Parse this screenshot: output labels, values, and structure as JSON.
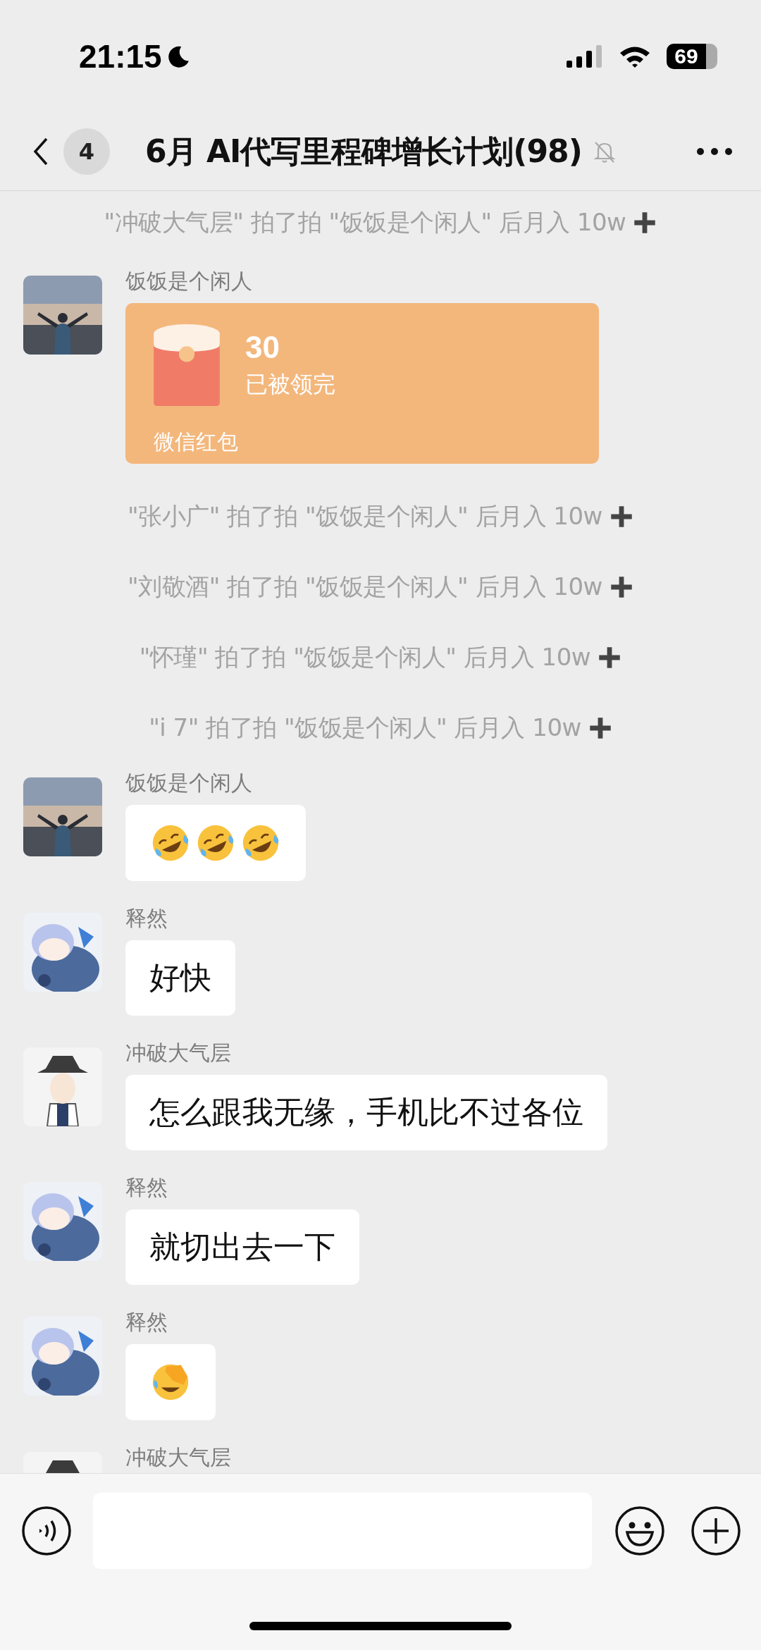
{
  "status_bar": {
    "time": "21:15",
    "battery": "69"
  },
  "nav": {
    "unread": "4",
    "title": "6月 AI代写里程碑增长计划(98)",
    "muted": true
  },
  "messages": [
    {
      "kind": "tickle",
      "text": "\"冲破大气层\" 拍了拍 \"饭饭是个闲人\" 后月入 10w"
    },
    {
      "kind": "red_packet",
      "sender": "饭饭是个闲人",
      "amount": "30",
      "status": "已被领完",
      "footer": "微信红包"
    },
    {
      "kind": "tickle",
      "text": "\"张小广\" 拍了拍 \"饭饭是个闲人\" 后月入 10w"
    },
    {
      "kind": "tickle",
      "text": "\"刘敬酒\" 拍了拍 \"饭饭是个闲人\" 后月入 10w"
    },
    {
      "kind": "tickle",
      "text": "\"怀瑾\" 拍了拍 \"饭饭是个闲人\" 后月入 10w"
    },
    {
      "kind": "tickle",
      "text": "\"i 7\" 拍了拍 \"饭饭是个闲人\" 后月入 10w"
    },
    {
      "kind": "sticker",
      "sender": "饭饭是个闲人",
      "stickers": [
        {
          "kind": "rofl"
        },
        {
          "kind": "rofl"
        },
        {
          "kind": "rofl"
        }
      ]
    },
    {
      "kind": "text",
      "sender": "释然",
      "avatar": {
        "kind": "anime"
      },
      "text": "好快"
    },
    {
      "kind": "text",
      "sender": "冲破大气层",
      "avatar": {
        "kind": "hat"
      },
      "text": "怎么跟我无缘，手机比不过各位"
    },
    {
      "kind": "text",
      "sender": "释然",
      "avatar": {
        "kind": "anime"
      },
      "text": "就切出去一下"
    },
    {
      "kind": "sticker",
      "sender": "释然",
      "avatar": {
        "kind": "anime"
      },
      "stickers": [
        {
          "kind": "facepalm"
        }
      ]
    },
    {
      "kind": "text",
      "sender": "冲破大气层",
      "avatar": {
        "kind": "hat"
      }
    }
  ]
}
